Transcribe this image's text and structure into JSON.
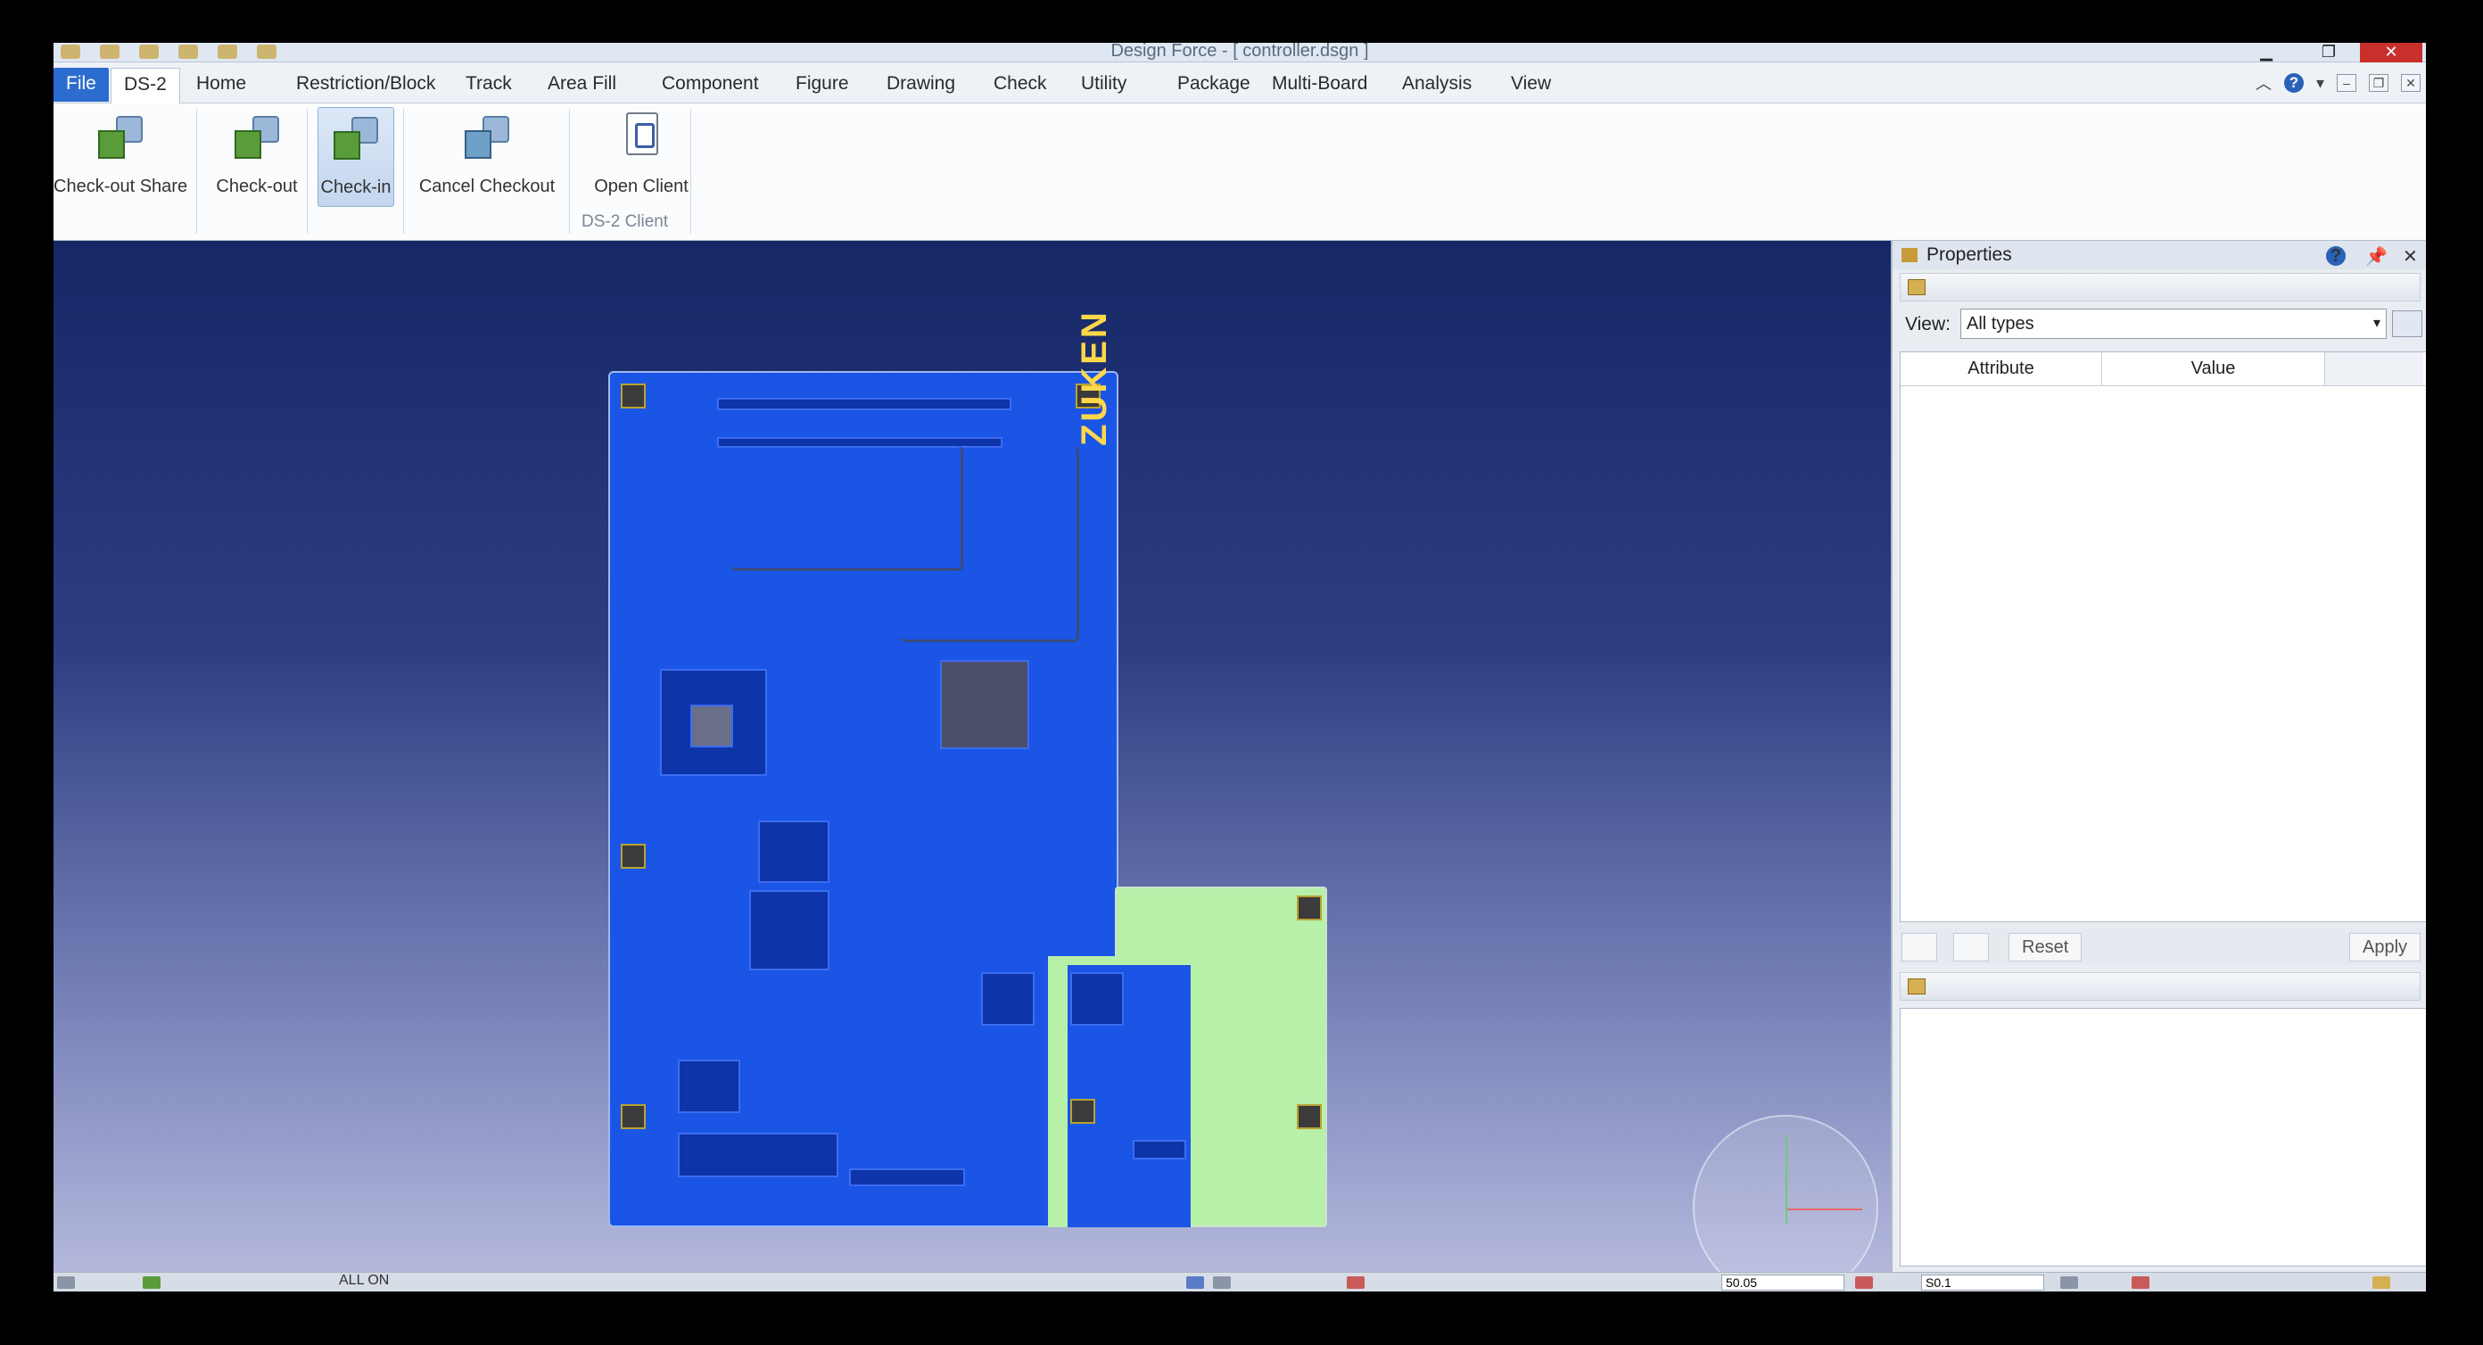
{
  "window": {
    "title": "Design Force - [ controller.dsgn ]"
  },
  "tabs": [
    "File",
    "DS-2",
    "Home",
    "Restriction/Block",
    "Track",
    "Area Fill",
    "Component",
    "Figure",
    "Drawing",
    "Check",
    "Utility",
    "Package",
    "Multi-Board",
    "Analysis",
    "View"
  ],
  "ribbon": {
    "buttons": [
      {
        "label": "Check-out Share"
      },
      {
        "label": "Check-out"
      },
      {
        "label": "Check-in"
      },
      {
        "label": "Cancel Checkout"
      },
      {
        "label": "Open Client"
      }
    ],
    "group_label": "DS-2 Client"
  },
  "board": {
    "logo_text": "ZUKEN",
    "layer_colors": {
      "top": "#1a55e6",
      "sub": "#b7f0a9"
    }
  },
  "properties": {
    "title": "Properties",
    "view_label": "View:",
    "view_value": "All types",
    "columns": [
      "Attribute",
      "Value"
    ],
    "reset_label": "Reset",
    "apply_label": "Apply"
  },
  "status": {
    "grid_value": "50.05",
    "scale_value": "S0.1",
    "layer_text": "ALL ON"
  },
  "colors": {
    "accent": "#2c6ccf",
    "canvas_top": "#152765",
    "canvas_bottom": "#b4b8dc",
    "close": "#c9302c"
  }
}
